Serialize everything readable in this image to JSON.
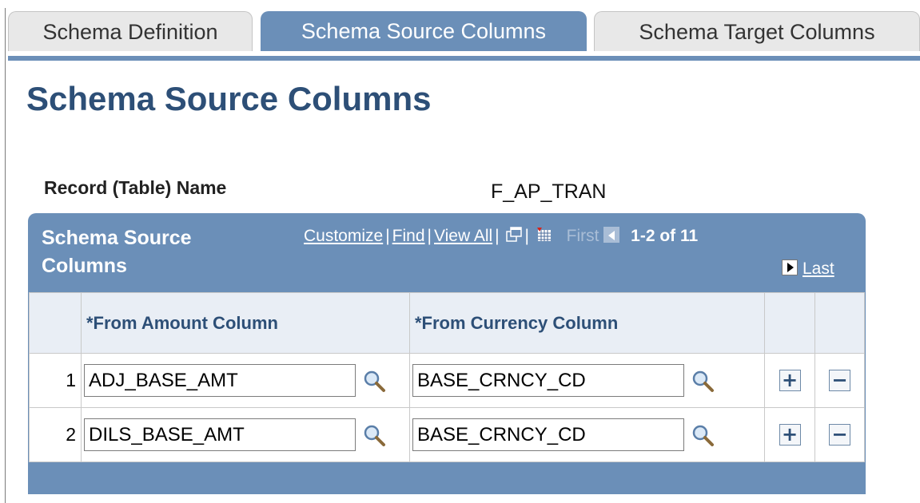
{
  "tabs": [
    {
      "label": "Schema Definition",
      "active": false
    },
    {
      "label": "Schema Source Columns",
      "active": true
    },
    {
      "label": "Schema Target Columns",
      "active": false
    }
  ],
  "page_title": "Schema Source Columns",
  "record": {
    "label": "Record (Table) Name",
    "value": "F_AP_TRAN"
  },
  "grid": {
    "title": "Schema Source Columns",
    "customize": "Customize",
    "find": "Find",
    "view_all": "View All",
    "first": "First",
    "count": "1-2 of 11",
    "last": "Last",
    "columns": [
      "*From Amount Column",
      "*From Currency Column"
    ],
    "rows": [
      {
        "num": "1",
        "amount": "ADJ_BASE_AMT",
        "currency": "BASE_CRNCY_CD"
      },
      {
        "num": "2",
        "amount": "DILS_BASE_AMT",
        "currency": "BASE_CRNCY_CD"
      }
    ],
    "add_symbol": "+",
    "delete_symbol": "−"
  },
  "colors": {
    "accent": "#6b8fb8",
    "title": "#2d4f77"
  },
  "icons": [
    "lookup-icon",
    "new-window-icon",
    "personalize-grid-icon",
    "previous-icon",
    "next-icon"
  ]
}
